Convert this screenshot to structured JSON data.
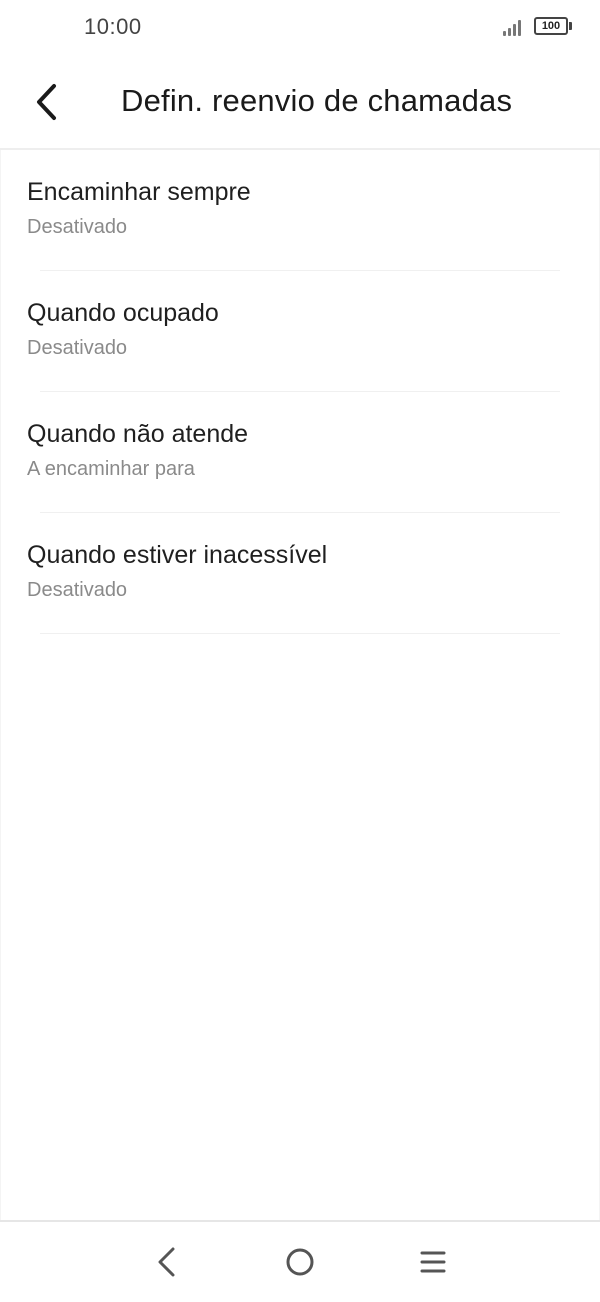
{
  "status_bar": {
    "time": "10:00",
    "signal_icon": "signal-bars-icon",
    "battery_level": "100"
  },
  "app_bar": {
    "title": "Defin. reenvio de chamadas",
    "back_icon": "chevron-left-icon"
  },
  "settings": {
    "items": [
      {
        "title": "Encaminhar sempre",
        "subtitle": "Desativado"
      },
      {
        "title": "Quando ocupado",
        "subtitle": "Desativado"
      },
      {
        "title": "Quando não atende",
        "subtitle": "A encaminhar para"
      },
      {
        "title": "Quando estiver inacessível",
        "subtitle": "Desativado"
      }
    ]
  },
  "nav_bar": {
    "back_icon": "triangle-back-icon",
    "home_icon": "circle-home-icon",
    "menu_icon": "hamburger-menu-icon"
  },
  "colors": {
    "text_primary": "#1f1f1f",
    "text_secondary": "#8a8a8a",
    "divider": "#eeeeee"
  }
}
